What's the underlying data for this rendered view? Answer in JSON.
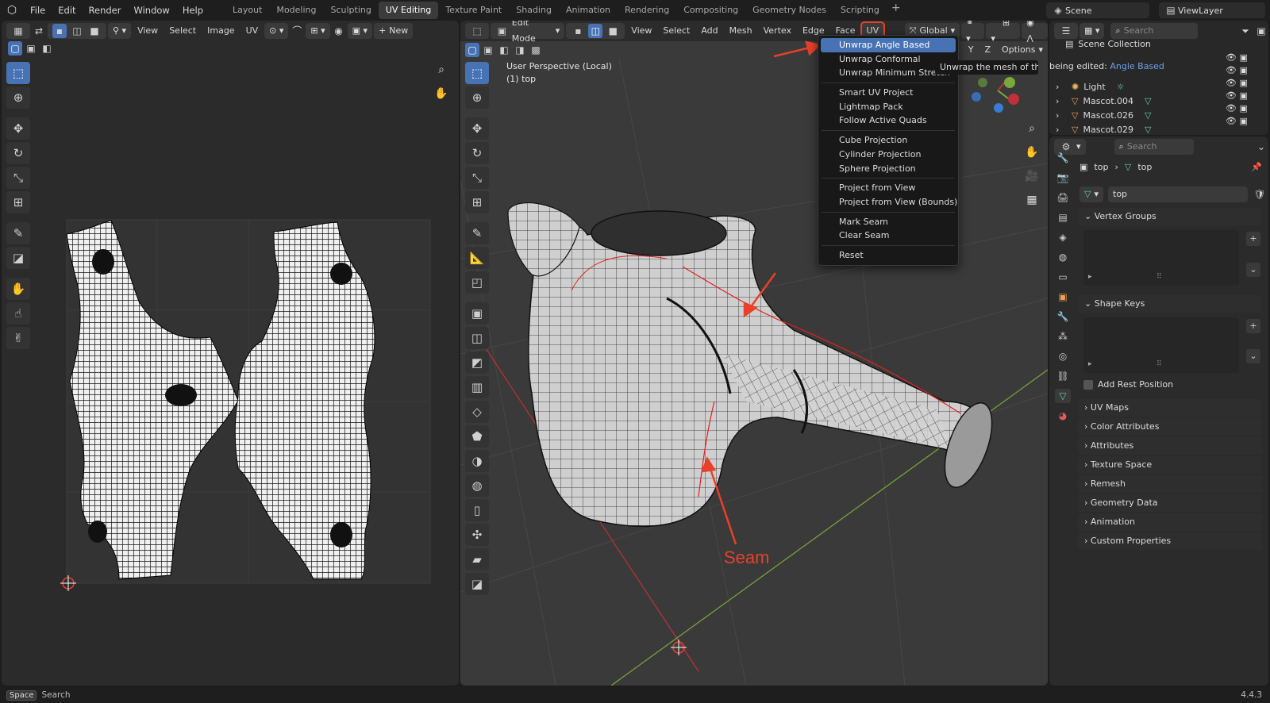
{
  "menubar": {
    "logo": "⬡",
    "items": [
      "File",
      "Edit",
      "Render",
      "Window",
      "Help"
    ],
    "workspaces": [
      "Layout",
      "Modeling",
      "Sculpting",
      "UV Editing",
      "Texture Paint",
      "Shading",
      "Animation",
      "Rendering",
      "Compositing",
      "Geometry Nodes",
      "Scripting"
    ],
    "active_workspace": "UV Editing",
    "add_symbol": "+",
    "scene": "Scene",
    "view_layer": "ViewLayer"
  },
  "uv_editor": {
    "menus": [
      "View",
      "Select",
      "Image",
      "UV"
    ],
    "new_label": "New"
  },
  "viewport": {
    "mode": "Edit Mode",
    "menus": [
      "View",
      "Select",
      "Add",
      "Mesh",
      "Vertex",
      "Edge",
      "Face",
      "UV"
    ],
    "transform": "Global",
    "options": "Options",
    "overlay_title": "User Perspective (Local)",
    "overlay_object": "(1) top",
    "annotation_label": "Seam"
  },
  "uv_menu": {
    "groups": [
      [
        "Unwrap Angle Based",
        "Unwrap Conformal",
        "Unwrap Minimum Stretch"
      ],
      [
        "Smart UV Project",
        "Lightmap Pack",
        "Follow Active Quads"
      ],
      [
        "Cube Projection",
        "Cylinder Projection",
        "Sphere Projection"
      ],
      [
        "Project from View",
        "Project from View (Bounds)"
      ],
      [
        "Mark Seam",
        "Clear Seam"
      ],
      [
        "Reset"
      ]
    ],
    "highlighted": "Unwrap Angle Based",
    "tooltip": "Unwrap the mesh of the ob"
  },
  "outliner": {
    "search_placeholder": "Search",
    "collection": "Scene Collection",
    "being_edited_prefix": "being edited:",
    "being_edited_value": "Angle Based",
    "items": [
      {
        "name": "Light"
      },
      {
        "name": "Mascot.004"
      },
      {
        "name": "Mascot.026"
      },
      {
        "name": "Mascot.029"
      }
    ]
  },
  "properties": {
    "search_placeholder": "Search",
    "breadcrumb_object": "top",
    "breadcrumb_data": "top",
    "mesh_name": "top",
    "panels": [
      "Vertex Groups",
      "Shape Keys"
    ],
    "add_rest_position": "Add Rest Position",
    "collapsed_panels": [
      "UV Maps",
      "Color Attributes",
      "Attributes",
      "Texture Space",
      "Remesh",
      "Geometry Data",
      "Animation",
      "Custom Properties"
    ]
  },
  "statusbar": {
    "key": "Space",
    "action": "Search",
    "version": "4.4.3"
  },
  "colors": {
    "accent": "#4772b3",
    "annotation": "#e8402a",
    "seam": "#e02020",
    "x_axis": "#c0303a",
    "y_axis": "#7aa83a"
  }
}
